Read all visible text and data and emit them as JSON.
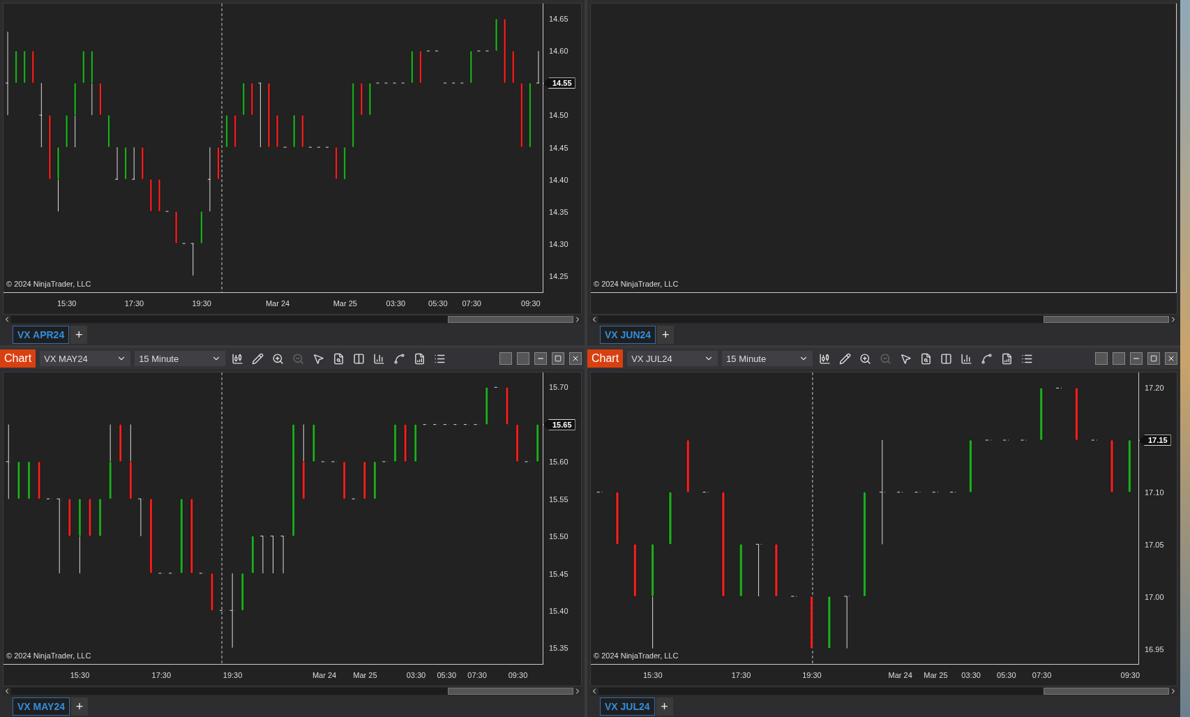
{
  "panels": [
    {
      "chart": {
        "chart_data": {
          "type": "candlestick",
          "ylim": [
            14.224,
            14.674
          ],
          "categories": [
            null,
            null,
            null,
            null,
            null,
            null,
            null,
            "15:30",
            null,
            null,
            null,
            null,
            null,
            null,
            null,
            "17:30",
            null,
            null,
            null,
            null,
            null,
            null,
            null,
            "19:30",
            null,
            null,
            null,
            null,
            null,
            null,
            null,
            null,
            "Mar 24",
            null,
            null,
            null,
            null,
            null,
            null,
            null,
            "Mar 25",
            null,
            null,
            null,
            null,
            null,
            "03:30",
            null,
            null,
            null,
            null,
            "05:30",
            null,
            null,
            null,
            "07:30",
            null,
            null,
            null,
            null,
            null,
            null,
            "09:30",
            null
          ],
          "ohlc": [
            [
              14.55,
              14.63,
              14.5,
              14.55
            ],
            [
              14.55,
              14.6,
              14.55,
              14.6
            ],
            [
              14.55,
              14.6,
              14.55,
              14.6
            ],
            [
              14.6,
              14.6,
              14.55,
              14.55
            ],
            [
              14.5,
              14.55,
              14.45,
              14.5
            ],
            [
              14.5,
              14.5,
              14.4,
              14.4
            ],
            [
              14.4,
              14.45,
              14.35,
              14.45
            ],
            [
              14.45,
              14.5,
              14.45,
              14.5
            ],
            [
              14.5,
              14.55,
              14.45,
              14.55
            ],
            [
              14.55,
              14.6,
              14.55,
              14.6
            ],
            [
              14.55,
              14.6,
              14.5,
              14.6
            ],
            [
              14.55,
              14.55,
              14.5,
              14.5
            ],
            [
              14.45,
              14.5,
              14.45,
              14.5
            ],
            [
              14.4,
              14.45,
              14.4,
              14.4
            ],
            [
              14.4,
              14.45,
              14.4,
              14.45
            ],
            [
              14.4,
              14.45,
              14.4,
              14.4
            ],
            [
              14.45,
              14.45,
              14.4,
              14.4
            ],
            [
              14.4,
              14.4,
              14.35,
              14.35
            ],
            [
              14.4,
              14.4,
              14.35,
              14.35
            ],
            [
              14.35,
              14.35,
              14.35,
              14.35
            ],
            [
              14.35,
              14.35,
              14.3,
              14.3
            ],
            [
              14.3,
              14.3,
              14.3,
              14.3
            ],
            [
              14.3,
              14.3,
              14.25,
              14.3
            ],
            [
              14.3,
              14.35,
              14.3,
              14.35
            ],
            [
              14.4,
              14.45,
              14.35,
              14.4
            ],
            [
              14.45,
              14.45,
              14.4,
              14.4
            ],
            [
              14.45,
              14.5,
              14.45,
              14.5
            ],
            [
              14.5,
              14.5,
              14.45,
              14.45
            ],
            [
              14.5,
              14.55,
              14.5,
              14.55
            ],
            [
              14.55,
              14.55,
              14.5,
              14.5
            ],
            [
              14.55,
              14.55,
              14.45,
              14.55
            ],
            [
              14.55,
              14.55,
              14.45,
              14.45
            ],
            [
              14.5,
              14.5,
              14.45,
              14.45
            ],
            [
              14.45,
              14.45,
              14.45,
              14.45
            ],
            [
              14.45,
              14.5,
              14.45,
              14.5
            ],
            [
              14.5,
              14.5,
              14.45,
              14.45
            ],
            [
              14.45,
              14.45,
              14.45,
              14.45
            ],
            [
              14.45,
              14.45,
              14.45,
              14.45
            ],
            [
              14.45,
              14.45,
              14.45,
              14.45
            ],
            [
              14.45,
              14.45,
              14.4,
              14.4
            ],
            [
              14.4,
              14.45,
              14.4,
              14.45
            ],
            [
              14.45,
              14.55,
              14.45,
              14.55
            ],
            [
              14.55,
              14.55,
              14.5,
              14.5
            ],
            [
              14.5,
              14.55,
              14.5,
              14.55
            ],
            [
              14.55,
              14.55,
              14.55,
              14.55
            ],
            [
              14.55,
              14.55,
              14.55,
              14.55
            ],
            [
              14.55,
              14.55,
              14.55,
              14.55
            ],
            [
              14.55,
              14.55,
              14.55,
              14.55
            ],
            [
              14.55,
              14.6,
              14.55,
              14.6
            ],
            [
              14.6,
              14.6,
              14.55,
              14.55
            ],
            [
              14.6,
              14.6,
              14.6,
              14.6
            ],
            [
              14.6,
              14.6,
              14.6,
              14.6
            ],
            [
              14.55,
              14.55,
              14.55,
              14.55
            ],
            [
              14.55,
              14.55,
              14.55,
              14.55
            ],
            [
              14.55,
              14.55,
              14.55,
              14.55
            ],
            [
              14.55,
              14.6,
              14.55,
              14.6
            ],
            [
              14.6,
              14.6,
              14.6,
              14.6
            ],
            [
              14.6,
              14.6,
              14.6,
              14.6
            ],
            [
              14.6,
              14.65,
              14.6,
              14.65
            ],
            [
              14.65,
              14.65,
              14.55,
              14.55
            ],
            [
              14.6,
              14.6,
              14.55,
              14.55
            ],
            [
              14.55,
              14.55,
              14.45,
              14.45
            ],
            [
              14.45,
              14.55,
              14.45,
              14.55
            ],
            [
              14.55,
              14.6,
              14.55,
              14.55
            ]
          ],
          "yticks": [
            {
              "value": 14.65,
              "label": "14.65"
            },
            {
              "value": 14.6,
              "label": "14.60"
            },
            {
              "value": 14.5,
              "label": "14.50"
            },
            {
              "value": 14.45,
              "label": "14.45"
            },
            {
              "value": 14.4,
              "label": "14.40"
            },
            {
              "value": 14.35,
              "label": "14.35"
            },
            {
              "value": 14.3,
              "label": "14.30"
            },
            {
              "value": 14.25,
              "label": "14.25"
            }
          ],
          "annotations": [
            "14.55"
          ]
        },
        "copyright": "© 2024 NinjaTrader, LLC"
      },
      "tabs": [
        {
          "label": "VX APR24",
          "selected": true
        }
      ],
      "add_tab": "+"
    },
    {
      "chart": {
        "copyright": "© 2024 NinjaTrader, LLC"
      },
      "tabs": [
        {
          "label": "VX JUN24",
          "selected": true
        }
      ],
      "add_tab": "+"
    },
    {
      "toolbar": {
        "button": "Chart",
        "instrument": "VX MAY24",
        "interval": "15 Minute"
      },
      "chart": {
        "chart_data": {
          "type": "candlestick",
          "ylim": [
            15.328,
            15.72
          ],
          "categories": [
            null,
            null,
            null,
            null,
            null,
            null,
            null,
            "15:30",
            null,
            null,
            null,
            null,
            null,
            null,
            null,
            "17:30",
            null,
            null,
            null,
            null,
            null,
            null,
            "19:30",
            null,
            null,
            null,
            null,
            null,
            null,
            null,
            null,
            "Mar 24",
            null,
            null,
            null,
            "Mar 25",
            null,
            null,
            null,
            null,
            "03:30",
            null,
            null,
            "05:30",
            null,
            null,
            "07:30",
            null,
            null,
            null,
            "09:30",
            null,
            null
          ],
          "ohlc": [
            [
              15.6,
              15.65,
              15.55,
              15.6
            ],
            [
              15.55,
              15.6,
              15.55,
              15.6
            ],
            [
              15.55,
              15.6,
              15.55,
              15.6
            ],
            [
              15.6,
              15.6,
              15.55,
              15.55
            ],
            [
              15.55,
              15.55,
              15.55,
              15.55
            ],
            [
              15.55,
              15.55,
              15.45,
              15.55
            ],
            [
              15.55,
              15.55,
              15.5,
              15.5
            ],
            [
              15.5,
              15.55,
              15.45,
              15.55
            ],
            [
              15.55,
              15.55,
              15.5,
              15.5
            ],
            [
              15.5,
              15.55,
              15.5,
              15.55
            ],
            [
              15.55,
              15.65,
              15.55,
              15.6
            ],
            [
              15.65,
              15.65,
              15.6,
              15.6
            ],
            [
              15.6,
              15.65,
              15.55,
              15.55
            ],
            [
              15.55,
              15.55,
              15.5,
              15.55
            ],
            [
              15.55,
              15.55,
              15.45,
              15.45
            ],
            [
              15.45,
              15.45,
              15.45,
              15.45
            ],
            [
              15.45,
              15.45,
              15.45,
              15.45
            ],
            [
              15.45,
              15.55,
              15.45,
              15.55
            ],
            [
              15.55,
              15.55,
              15.45,
              15.45
            ],
            [
              15.45,
              15.45,
              15.45,
              15.45
            ],
            [
              15.45,
              15.45,
              15.4,
              15.4
            ],
            [
              15.4,
              15.4,
              15.4,
              15.4
            ],
            [
              15.4,
              15.45,
              15.35,
              15.4
            ],
            [
              15.4,
              15.45,
              15.4,
              15.45
            ],
            [
              15.45,
              15.5,
              15.45,
              15.5
            ],
            [
              15.5,
              15.5,
              15.45,
              15.5
            ],
            [
              15.5,
              15.5,
              15.45,
              15.5
            ],
            [
              15.5,
              15.5,
              15.45,
              15.5
            ],
            [
              15.5,
              15.65,
              15.5,
              15.65
            ],
            [
              15.6,
              15.65,
              15.55,
              15.55
            ],
            [
              15.6,
              15.65,
              15.6,
              15.65
            ],
            [
              15.6,
              15.6,
              15.6,
              15.6
            ],
            [
              15.6,
              15.6,
              15.6,
              15.6
            ],
            [
              15.6,
              15.6,
              15.55,
              15.55
            ],
            [
              15.55,
              15.55,
              15.55,
              15.55
            ],
            [
              15.6,
              15.6,
              15.55,
              15.55
            ],
            [
              15.55,
              15.6,
              15.55,
              15.6
            ],
            [
              15.6,
              15.6,
              15.6,
              15.6
            ],
            [
              15.6,
              15.65,
              15.6,
              15.65
            ],
            [
              15.65,
              15.65,
              15.6,
              15.6
            ],
            [
              15.6,
              15.65,
              15.6,
              15.65
            ],
            [
              15.65,
              15.65,
              15.65,
              15.65
            ],
            [
              15.65,
              15.65,
              15.65,
              15.65
            ],
            [
              15.65,
              15.65,
              15.65,
              15.65
            ],
            [
              15.65,
              15.65,
              15.65,
              15.65
            ],
            [
              15.65,
              15.65,
              15.65,
              15.65
            ],
            [
              15.65,
              15.65,
              15.65,
              15.65
            ],
            [
              15.65,
              15.7,
              15.65,
              15.7
            ],
            [
              15.7,
              15.7,
              15.7,
              15.7
            ],
            [
              15.7,
              15.7,
              15.65,
              15.65
            ],
            [
              15.65,
              15.65,
              15.6,
              15.6
            ],
            [
              15.6,
              15.6,
              15.6,
              15.6
            ],
            [
              15.6,
              15.65,
              15.6,
              15.65
            ]
          ],
          "yticks": [
            {
              "value": 15.7,
              "label": "15.70"
            },
            {
              "value": 15.6,
              "label": "15.60"
            },
            {
              "value": 15.55,
              "label": "15.55"
            },
            {
              "value": 15.5,
              "label": "15.50"
            },
            {
              "value": 15.45,
              "label": "15.45"
            },
            {
              "value": 15.4,
              "label": "15.40"
            },
            {
              "value": 15.35,
              "label": "15.35"
            }
          ],
          "annotations": [
            "15.65"
          ]
        },
        "copyright": "© 2024 NinjaTrader, LLC"
      },
      "tabs": [
        {
          "label": "VX MAY24",
          "selected": true
        }
      ],
      "add_tab": "+"
    },
    {
      "toolbar": {
        "button": "Chart",
        "instrument": "VX JUL24",
        "interval": "15 Minute"
      },
      "chart": {
        "chart_data": {
          "type": "candlestick",
          "ylim": [
            16.935,
            17.215
          ],
          "categories": [
            null,
            null,
            null,
            "15:30",
            null,
            null,
            null,
            null,
            "17:30",
            null,
            null,
            null,
            "19:30",
            null,
            null,
            null,
            null,
            "Mar 24",
            null,
            "Mar 25",
            null,
            "03:30",
            null,
            "05:30",
            null,
            "07:30",
            null,
            null,
            null,
            null,
            "09:30"
          ],
          "ohlc": [
            [
              17.1,
              17.1,
              17.1,
              17.1
            ],
            [
              17.1,
              17.1,
              17.05,
              17.05
            ],
            [
              17.05,
              17.05,
              17.0,
              17.0
            ],
            [
              17.0,
              17.05,
              16.95,
              17.05
            ],
            [
              17.05,
              17.1,
              17.05,
              17.1
            ],
            [
              17.15,
              17.15,
              17.1,
              17.1
            ],
            [
              17.1,
              17.1,
              17.1,
              17.1
            ],
            [
              17.1,
              17.1,
              17.0,
              17.0
            ],
            [
              17.0,
              17.05,
              17.0,
              17.05
            ],
            [
              17.05,
              17.05,
              17.0,
              17.05
            ],
            [
              17.05,
              17.05,
              17.0,
              17.0
            ],
            [
              17.0,
              17.0,
              17.0,
              17.0
            ],
            [
              17.0,
              17.0,
              16.95,
              16.95
            ],
            [
              16.95,
              17.0,
              16.95,
              17.0
            ],
            [
              17.0,
              17.0,
              16.95,
              17.0
            ],
            [
              17.0,
              17.1,
              17.0,
              17.1
            ],
            [
              17.1,
              17.15,
              17.05,
              17.1
            ],
            [
              17.1,
              17.1,
              17.1,
              17.1
            ],
            [
              17.1,
              17.1,
              17.1,
              17.1
            ],
            [
              17.1,
              17.1,
              17.1,
              17.1
            ],
            [
              17.1,
              17.1,
              17.1,
              17.1
            ],
            [
              17.1,
              17.15,
              17.1,
              17.15
            ],
            [
              17.15,
              17.15,
              17.15,
              17.15
            ],
            [
              17.15,
              17.15,
              17.15,
              17.15
            ],
            [
              17.15,
              17.15,
              17.15,
              17.15
            ],
            [
              17.15,
              17.2,
              17.15,
              17.2
            ],
            [
              17.2,
              17.2,
              17.2,
              17.2
            ],
            [
              17.2,
              17.2,
              17.15,
              17.15
            ],
            [
              17.15,
              17.15,
              17.15,
              17.15
            ],
            [
              17.15,
              17.15,
              17.1,
              17.1
            ],
            [
              17.1,
              17.15,
              17.1,
              17.15
            ]
          ],
          "yticks": [
            {
              "value": 17.2,
              "label": "17.20"
            },
            {
              "value": 17.1,
              "label": "17.10"
            },
            {
              "value": 17.05,
              "label": "17.05"
            },
            {
              "value": 17.0,
              "label": "17.00"
            },
            {
              "value": 16.95,
              "label": "16.95"
            }
          ],
          "annotations": [
            "17.15"
          ]
        },
        "copyright": "© 2024 NinjaTrader, LLC"
      },
      "tabs": [
        {
          "label": "VX JUL24",
          "selected": true
        }
      ],
      "add_tab": "+"
    }
  ]
}
